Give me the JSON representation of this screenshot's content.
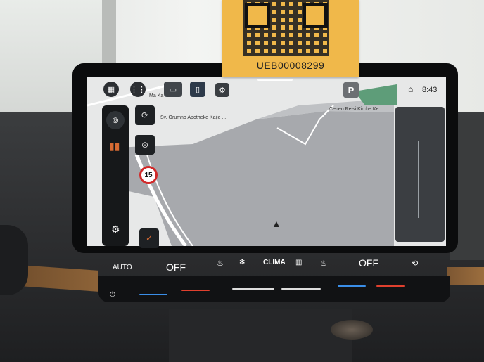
{
  "sticker": {
    "code": "UEB00008299"
  },
  "status": {
    "time": "8:43",
    "home_icon": "home-icon",
    "park_label": "P"
  },
  "top_bar": {
    "home_icon": "windows-grid-icon",
    "apps_icon": "apps-grid-icon",
    "car_icon": "car-icon",
    "phone_icon": "phone-icon",
    "settings_icon": "settings-icon"
  },
  "map": {
    "speed_limit": "15",
    "poi_1": "Sv. Orumno Apotheke Kaije ...",
    "poi_2": "Ceneo Reisi Kirche Ke",
    "poi_3": "Ma Ka",
    "icons": [
      "navigation-icon",
      "map-icon",
      "route-icon",
      "zoom-icon",
      "poi-icon",
      "gear-icon"
    ]
  },
  "climate": {
    "auto_label": "AUTO",
    "left_off": "OFF",
    "center_label": "CLIMA",
    "right_off": "OFF",
    "icons": [
      "seat-heat-left-icon",
      "fan-icon",
      "defrost-icon",
      "seat-heat-right-icon",
      "recirculation-car-icon",
      "power-icon"
    ]
  },
  "colors": {
    "accent_orange": "#d86b33",
    "heat_red": "#e0402e",
    "cool_blue": "#3a8ee8",
    "sticker": "#f0b84a"
  }
}
